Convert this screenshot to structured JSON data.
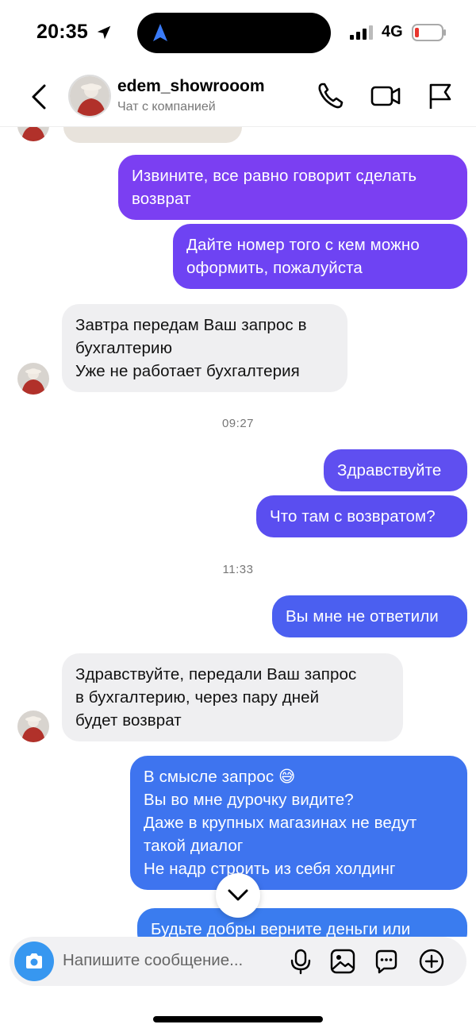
{
  "status": {
    "time": "20:35",
    "network": "4G"
  },
  "header": {
    "name": "edem_showrooom",
    "subtitle": "Чат с компанией"
  },
  "messages": [
    {
      "dir": "out",
      "lines": [
        "Извините, все равно говорит сделать",
        "возврат"
      ]
    },
    {
      "dir": "out",
      "lines": [
        "Дайте номер того с кем можно",
        "оформить, пожалуйста"
      ]
    },
    {
      "dir": "in",
      "lines": [
        "Завтра передам Ваш запрос в",
        "бухгалтерию",
        "Уже не работает бухгалтерия"
      ]
    },
    {
      "dir": "time",
      "text": "09:27"
    },
    {
      "dir": "out",
      "lines": [
        "Здравствуйте"
      ]
    },
    {
      "dir": "out",
      "lines": [
        "Что там с возвратом?"
      ]
    },
    {
      "dir": "time",
      "text": "11:33"
    },
    {
      "dir": "out",
      "lines": [
        "Вы мне не ответили"
      ]
    },
    {
      "dir": "in",
      "lines": [
        "Здравствуйте, передали Ваш запрос",
        "в бухгалтерию, через пару дней",
        "будет возврат"
      ]
    },
    {
      "dir": "out",
      "lines": [
        "В смысле запрос 😅",
        "Вы во мне дурочку видите?",
        "Даже в крупных магазинах не ведут",
        "такой диалог",
        "Не надр строить из себя холдинг"
      ]
    },
    {
      "dir": "out",
      "lines": [
        "Будьте добры верните деньги или"
      ]
    }
  ],
  "composer": {
    "placeholder": "Напишите сообщение..."
  },
  "colors": {
    "purple": "#7b3ff2",
    "violet": "#5d4ef0",
    "blue": "#3e74ef",
    "incoming": "#efeff1"
  }
}
